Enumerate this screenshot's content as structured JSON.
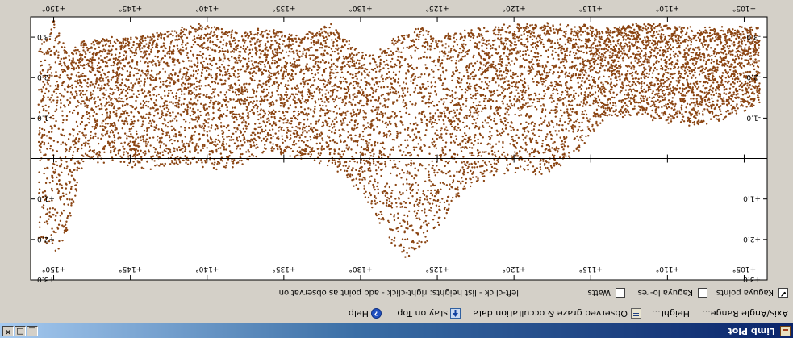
{
  "window": {
    "title": "Limb Plot"
  },
  "menu": {
    "axis_range_label": "Axis/Angle Range...",
    "height_label": "Height...",
    "observed_label": "Observed graze & occultation data",
    "stay_on_top_label": "stay on Top",
    "help_label": "Help"
  },
  "options": {
    "kaguya_points_label": "Kaguya points",
    "kaguya_points_checked": true,
    "kaguya_lores_label": "Kaguya lo-res",
    "kaguya_lores_checked": false,
    "watts_label": "Watts",
    "watts_checked": false,
    "hint_text": "left-click - list heights;   right-click - add point as observation"
  },
  "icons": {
    "app": "limb-plot-app-icon",
    "observed": "observed-data-icon",
    "stay_on_top": "pin-icon",
    "help": "help-icon"
  },
  "colors": {
    "points": "#8b4513",
    "title_start": "#0a246a",
    "title_end": "#a6caf0",
    "plot_bg": "#ffffff"
  },
  "chart_data": {
    "type": "scatter",
    "xlabel": "",
    "ylabel": "",
    "xlim": [
      103.5,
      151.5
    ],
    "ylim": [
      3.0,
      -3.5
    ],
    "x_ticks": [
      "+105°",
      "+110°",
      "+115°",
      "+120°",
      "+125°",
      "+130°",
      "+135°",
      "+140°",
      "+145°",
      "+150°"
    ],
    "x_tick_values": [
      105,
      110,
      115,
      120,
      125,
      130,
      135,
      140,
      145,
      150
    ],
    "y_ticks": [
      "+3.0",
      "+2.0",
      "+1.0",
      "-1.0",
      "-2.0",
      "-3.0"
    ],
    "y_tick_values": [
      3,
      2,
      1,
      -1,
      -2,
      -3
    ],
    "series": [
      {
        "color": "#8b4513",
        "profile": {
          "x": [
            104,
            106,
            108,
            110,
            112,
            114,
            116,
            118,
            120,
            122,
            124,
            125,
            126,
            127,
            128,
            129,
            130,
            132,
            134,
            136,
            138,
            140,
            142,
            144,
            146,
            148,
            149,
            150,
            151
          ],
          "top": [
            -3.2,
            -3.2,
            -3.2,
            -3.3,
            -3.3,
            -3.2,
            -3.3,
            -3.3,
            -3.3,
            -3.2,
            -3.1,
            -2.9,
            -3.3,
            -3.1,
            -2.9,
            -2.6,
            -2.6,
            -3.3,
            -3.0,
            -3.2,
            -3.1,
            -3.3,
            -3.2,
            -3.0,
            -3.0,
            -2.9,
            -2.6,
            -3.4,
            -2.8
          ],
          "bottom": [
            -1.4,
            -1.0,
            -0.8,
            -0.9,
            -1.1,
            -1.0,
            -0.1,
            0.4,
            0.3,
            0.5,
            1.1,
            1.8,
            2.2,
            2.4,
            2.2,
            1.4,
            0.8,
            0.2,
            0.0,
            -0.2,
            0.2,
            0.3,
            0.1,
            0.3,
            0.1,
            0.0,
            1.7,
            2.5,
            1.9
          ]
        }
      }
    ]
  }
}
